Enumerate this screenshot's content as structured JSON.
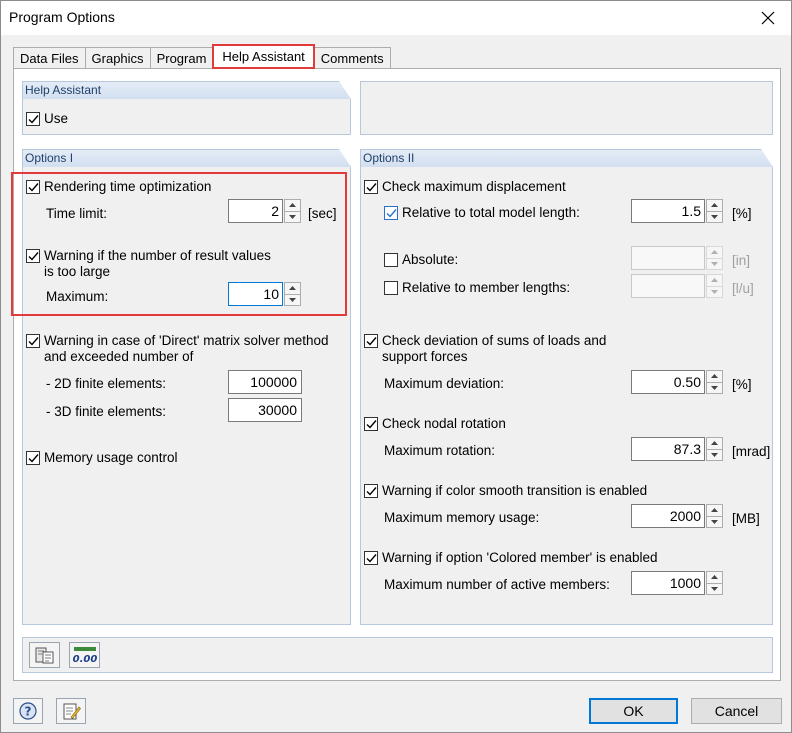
{
  "window": {
    "title": "Program Options"
  },
  "tabs": [
    "Data Files",
    "Graphics",
    "Program",
    "Help Assistant",
    "Comments"
  ],
  "help_assistant": {
    "header": "Help Assistant",
    "use_label": "Use"
  },
  "options1": {
    "header": "Options I",
    "rendering": {
      "label": "Rendering time optimization",
      "time_limit_label": "Time limit:",
      "time_limit_value": "2",
      "time_limit_unit": "[sec]"
    },
    "result_warning": {
      "label_line1": "Warning if the number of result values",
      "label_line2": "is too large",
      "maximum_label": "Maximum:",
      "maximum_value": "10"
    },
    "direct_solver": {
      "label_line1": "Warning in case of 'Direct' matrix solver method",
      "label_line2": "and exceeded number of",
      "fe2d_label": "- 2D finite elements:",
      "fe2d_value": "100000",
      "fe3d_label": "- 3D finite elements:",
      "fe3d_value": "30000"
    },
    "memory_label": "Memory usage control"
  },
  "options2": {
    "header": "Options II",
    "max_disp": {
      "label": "Check maximum displacement",
      "relative_label": "Relative to total model length:",
      "relative_value": "1.5",
      "relative_unit": "[%]",
      "absolute_label": "Absolute:",
      "absolute_value": "",
      "absolute_unit": "[in]",
      "member_label": "Relative to member lengths:",
      "member_value": "",
      "member_unit": "[l/u]"
    },
    "deviation": {
      "label_line1": "Check deviation of sums of loads and",
      "label_line2": "support forces",
      "max_label": "Maximum deviation:",
      "max_value": "0.50",
      "max_unit": "[%]"
    },
    "rotation": {
      "label": "Check nodal rotation",
      "max_label": "Maximum rotation:",
      "max_value": "87.3",
      "max_unit": "[mrad]"
    },
    "smooth": {
      "label": "Warning if color smooth transition is enabled",
      "max_label": "Maximum memory usage:",
      "max_value": "2000",
      "max_unit": "[MB]"
    },
    "colored": {
      "label": "Warning if option 'Colored member' is enabled",
      "max_label": "Maximum number of active members:",
      "max_value": "1000"
    }
  },
  "toolbar": {
    "decimal_icon_text": "0.00"
  },
  "buttons": {
    "ok": "OK",
    "cancel": "Cancel"
  }
}
